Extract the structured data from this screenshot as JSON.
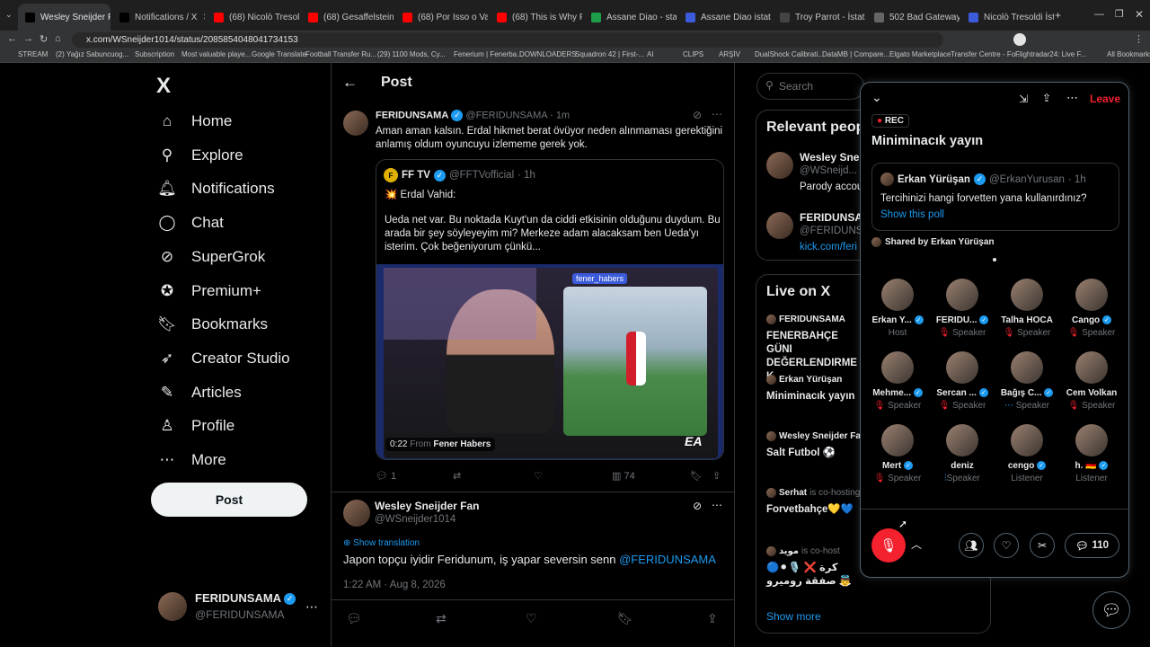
{
  "browser": {
    "tabs": [
      {
        "label": "Wesley Sneijder Fan o",
        "color": "#000000",
        "active": true
      },
      {
        "label": "Notifications / X",
        "color": "#000000"
      },
      {
        "label": "(68) Nicolò Tresoldi - Bea",
        "color": "#ff0000"
      },
      {
        "label": "(68) Gesaffelstein - Opr",
        "color": "#ff0000"
      },
      {
        "label": "(68) Por Isso o Vasco que",
        "color": "#ff0000"
      },
      {
        "label": "(68) This is Why Fulham W",
        "color": "#ff0000"
      },
      {
        "label": "Assane Diao - stats, caree",
        "color": "#1e9e4a"
      },
      {
        "label": "Assane Diao istatistikleri",
        "color": "#3b5bdb"
      },
      {
        "label": "Troy Parrot - İstatistik, Ma",
        "color": "#444444"
      },
      {
        "label": "502 Bad Gateway",
        "color": "#666666"
      },
      {
        "label": "Nicolò Tresoldi İstatistikl",
        "color": "#3b5bdb"
      }
    ],
    "url": "x.com/WSneijder1014/status/2085854048041734153",
    "bookmarks": [
      "STREAM",
      "(2) Yağız Sabuncuog...",
      "Subscription",
      "Most valuable playe...",
      "Google Translate",
      "Football Transfer Ru...",
      "(29) 1100 Mods, Cy...",
      "Fenerium | Fenerba...",
      "DOWNLOADERS",
      "Squadron 42 | First-...",
      "AI",
      "CLIPS",
      "ARŞİV",
      "DualShock Calibrati...",
      "DataMB | Compare...",
      "Elgato Marketplace",
      "Transfer Centre - Fo...",
      "Flightradar24: Live F...",
      "All Bookmarks"
    ]
  },
  "nav": {
    "logo": "X",
    "items": [
      {
        "label": "Home",
        "icon": "home-icon",
        "glyph": "⌂"
      },
      {
        "label": "Explore",
        "icon": "search-icon",
        "glyph": "⚲"
      },
      {
        "label": "Notifications",
        "icon": "bell-icon",
        "glyph": "🔔︎"
      },
      {
        "label": "Chat",
        "icon": "chat-icon",
        "glyph": "◯"
      },
      {
        "label": "SuperGrok",
        "icon": "grok-icon",
        "glyph": "⊘"
      },
      {
        "label": "Premium+",
        "icon": "premium-icon",
        "glyph": "✪"
      },
      {
        "label": "Bookmarks",
        "icon": "bookmark-icon",
        "glyph": "🔖︎"
      },
      {
        "label": "Creator Studio",
        "icon": "rocket-icon",
        "glyph": "➶"
      },
      {
        "label": "Articles",
        "icon": "articles-icon",
        "glyph": "✎"
      },
      {
        "label": "Profile",
        "icon": "person-icon",
        "glyph": "♙"
      },
      {
        "label": "More",
        "icon": "more-icon",
        "glyph": "⋯"
      }
    ],
    "post_button": "Post",
    "account": {
      "name": "FERIDUNSAMA",
      "handle": "@FERIDUNSAMA"
    }
  },
  "post_page": {
    "title": "Post",
    "tweet": {
      "name": "FERIDUNSAMA",
      "handle": "@FERIDUNSAMA",
      "time": "· 1m",
      "text": "Aman aman kalsın. Erdal hikmet berat övüyor neden alınmaması gerektiğini anlamış oldum oyuncuyu izlememe gerek yok.",
      "quote": {
        "name": "FF TV",
        "handle": "@FFTVofficial",
        "time": "· 1h",
        "line1": "💥 Erdal Vahid:",
        "body": "Ueda net var. Bu noktada Kuyt'un da ciddi etkisinin olduğunu duydum. Bu arada bir şey söyleyeyim mi? Merkeze adam alacaksam ben Ueda'yı isterim. Çok beğeniyorum çünkü...",
        "video_time": "0:22",
        "video_from": "From",
        "video_source": "Fener Habers",
        "overlay_tag": "fener_habers"
      },
      "stats": {
        "replies": "1",
        "views": "74"
      }
    },
    "reply": {
      "name": "Wesley Sneijder Fan",
      "handle": "@WSneijder1014",
      "show_translation": "Show translation",
      "text_prefix": "Japon topçu iyidir Feridunum, iş yapar seversin senn ",
      "mention": "@FERIDUNSAMA",
      "timestamp": "1:22 AM · Aug 8, 2026"
    }
  },
  "right": {
    "search_placeholder": "Search",
    "relevant_title": "Relevant peop",
    "relevant": [
      {
        "name": "Wesley Sneij",
        "handle": "@WSneijd...",
        "bio": "Parody accou"
      },
      {
        "name": "FERIDUNSAM",
        "handle": "@FERIDUNS",
        "bio": "kick.com/feri"
      }
    ],
    "live_title": "Live on X",
    "live": [
      {
        "host": "FERIDUNSAMA",
        "title": "FENERBAHÇE GÜNI DEĞERLENDIRME K"
      },
      {
        "host": "Erkan Yürüşan",
        "title": "Miniminacık yayın"
      },
      {
        "host": "Wesley Sneijder Fa",
        "title": "Salt Futbol ⚽"
      },
      {
        "host": "Serhat",
        "cohost": "is co-hosting",
        "title": "Forvetbahçe💛💙"
      },
      {
        "host": "مويد",
        "cohost": "is co-host",
        "title": "🔵⚫🎙️ كرة ❌ صفقة روميرو 👼"
      }
    ],
    "show_more": "Show more"
  },
  "space": {
    "rec": "REC",
    "leave": "Leave",
    "title": "Miniminacık yayın",
    "shared_post": {
      "name": "Erkan Yürüşan",
      "handle": "@ErkanYurusan",
      "time": "· 1h",
      "text": "Tercihinizi hangi forvetten yana kullanırdınız?",
      "link": "Show this poll"
    },
    "shared_by": "Shared by Erkan Yürüşan",
    "participants": [
      {
        "name": "Erkan Y...",
        "role": "Host",
        "verified": true,
        "muted": false
      },
      {
        "name": "FERIDU...",
        "role": "Speaker",
        "verified": true,
        "muted": true
      },
      {
        "name": "Talha HOCA",
        "role": "Speaker",
        "verified": false,
        "muted": true
      },
      {
        "name": "Cango",
        "role": "Speaker",
        "verified": true,
        "muted": true
      },
      {
        "name": "Mehme...",
        "role": "Speaker",
        "verified": true,
        "muted": true
      },
      {
        "name": "Sercan ...",
        "role": "Speaker",
        "verified": true,
        "muted": true
      },
      {
        "name": "Bağış C...",
        "role": "Speaker",
        "verified": true,
        "muted": false,
        "dots": true
      },
      {
        "name": "Cem Volkan",
        "role": "Speaker",
        "verified": false,
        "muted": true
      },
      {
        "name": "Mert",
        "role": "Speaker",
        "verified": true,
        "muted": true
      },
      {
        "name": "deniz",
        "role": "Speaker",
        "verified": false,
        "muted": false,
        "talking": true
      },
      {
        "name": "cengo",
        "role": "Listener",
        "verified": true,
        "muted": false
      },
      {
        "name": "h. 🇩🇪",
        "role": "Listener",
        "verified": true,
        "muted": false
      }
    ],
    "comment_count": "110"
  }
}
